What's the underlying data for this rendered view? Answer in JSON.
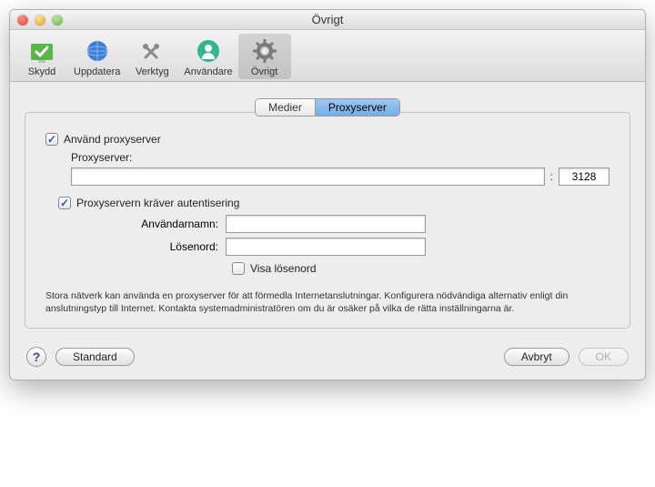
{
  "window_title": "Övrigt",
  "toolbar": {
    "items": [
      {
        "label": "Skydd"
      },
      {
        "label": "Uppdatera"
      },
      {
        "label": "Verktyg"
      },
      {
        "label": "Användare"
      },
      {
        "label": "Övrigt"
      }
    ],
    "active_index": 4
  },
  "subtabs": {
    "items": [
      "Medier",
      "Proxyserver"
    ],
    "active_index": 1
  },
  "form": {
    "use_proxy_label": "Använd proxyserver",
    "use_proxy_checked": true,
    "proxy_label": "Proxyserver:",
    "proxy_host_value": "",
    "proxy_port_value": "3128",
    "auth_label": "Proxyservern kräver autentisering",
    "auth_checked": true,
    "username_label": "Användarnamn:",
    "username_value": "",
    "password_label": "Lösenord:",
    "password_value": "",
    "show_password_label": "Visa lösenord",
    "show_password_checked": false,
    "help_text": "Stora nätverk kan använda en proxyserver för att förmedla Internetanslutningar. Konfigurera nödvändiga alternativ enligt din anslutningstyp till Internet. Kontakta systemadministratören om du är osäker på vilka de rätta inställningarna är."
  },
  "footer": {
    "standard": "Standard",
    "cancel": "Avbryt",
    "ok": "OK"
  }
}
